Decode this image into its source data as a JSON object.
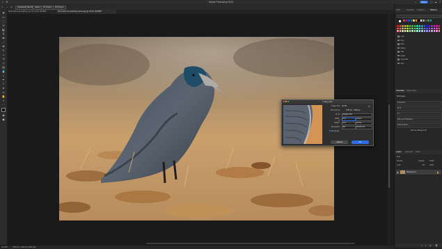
{
  "titlebar": {
    "title": "Adobe Photoshop 2024",
    "share_label": "Share"
  },
  "optionsbar": {
    "buttons": [
      "Contextual Task Bar",
      "Select",
      "Fit Screen",
      "Fill Screen"
    ]
  },
  "document": {
    "tabs": [
      "Rook-bird-crow-walking-.psd @ 33.3% (RGB/8)",
      "Rook-bird-crow-standing-leaves.jpg @ 33.3% (RGB/8)*"
    ]
  },
  "status": {
    "zoom": "33.33%",
    "info": "5760 px x 3840 px (300 ppi)"
  },
  "panels": {
    "swatch_tabs": [
      "Color",
      "Swatches",
      "Gradients",
      "Patterns"
    ],
    "swatch_groups": [
      "Light",
      "Pure",
      "Dark",
      "Darker",
      "Pale",
      "Pastel",
      "Grayscale",
      "Web"
    ],
    "properties_tabs": [
      "Properties",
      "Adjustments"
    ],
    "properties_title": "Pixel Layer",
    "properties_rows": [
      "Transform",
      "W  H",
      "X  Y",
      "Align and Distribute",
      "Quick Actions"
    ],
    "quick_action_note": "Remove Background",
    "layers_tabs": [
      "Layers",
      "Channels",
      "Paths"
    ],
    "layer_kind": "Kind",
    "blend_mode": "Normal",
    "opacity_label": "Opacity:",
    "opacity_value": "100%",
    "lock_label": "Lock:",
    "fill_label": "Fill:",
    "fill_value": "100%",
    "layer_name": "Background"
  },
  "dialog": {
    "title": "Image Size",
    "image_size_label": "Image Size:",
    "image_size_value": "63.3M",
    "dimensions_label": "Dimensions:",
    "dimensions_value": "5760 px × 3840 px",
    "fit_to_label": "Fit To:",
    "fit_to_value": "Original Size",
    "width_label": "Width:",
    "width_value": "19.2",
    "width_unit": "Inches",
    "height_label": "Height:",
    "height_value": "12.8",
    "height_unit": "Inches",
    "resolution_label": "Resolution:",
    "resolution_value": "300",
    "resolution_unit": "Pixels/Inch",
    "resample_label": "Resample:",
    "cancel_label": "Cancel",
    "ok_label": "OK"
  },
  "colors": {
    "accent": "#2b6ee6",
    "panel_bg": "#262626",
    "canvas_bg": "#1a1a1a"
  }
}
